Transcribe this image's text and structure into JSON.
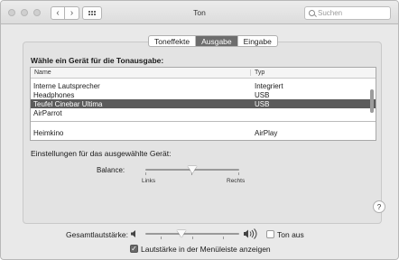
{
  "window": {
    "title": "Ton"
  },
  "toolbar": {
    "back_glyph": "‹",
    "forward_glyph": "›",
    "search_placeholder": "Suchen"
  },
  "tabs": [
    {
      "label": "Toneffekte",
      "active": false
    },
    {
      "label": "Ausgabe",
      "active": true
    },
    {
      "label": "Eingabe",
      "active": false
    }
  ],
  "output": {
    "heading": "Wähle ein Gerät für die Tonausgabe:",
    "columns": {
      "name": "Name",
      "type": "Typ"
    },
    "devices": [
      {
        "name": "Interne Lautsprecher",
        "type": "Integriert",
        "selected": false
      },
      {
        "name": "Headphones",
        "type": "USB",
        "selected": false
      },
      {
        "name": "Teufel Cinebar Ultima",
        "type": "USB",
        "selected": true
      },
      {
        "name": "AirParrot",
        "type": "",
        "selected": false
      },
      {
        "name": "Heimkino",
        "type": "AirPlay",
        "selected": false
      }
    ],
    "settings_label": "Einstellungen für das ausgewählte Gerät:",
    "balance": {
      "label": "Balance:",
      "left_label": "Links",
      "right_label": "Rechts",
      "value": 0.5
    }
  },
  "help": {
    "glyph": "?"
  },
  "volume": {
    "label": "Gesamtlautstärke:",
    "level": 0.38,
    "mute_label": "Ton aus",
    "mute_checked": false,
    "menubar_label": "Lautstärke in der Menüleiste anzeigen",
    "menubar_checked": true
  },
  "colors": {
    "selection": "#5b5b5b",
    "active_tab": "#6d6d6d",
    "panel": "#e3e3e3",
    "window": "#e9e9e9"
  }
}
